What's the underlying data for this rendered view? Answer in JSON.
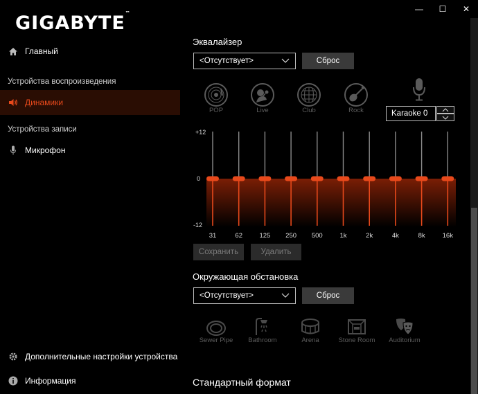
{
  "window": {
    "minimize": "—",
    "maximize": "☐",
    "close": "✕"
  },
  "brand": {
    "logo": "GIGABYTE",
    "tm": "™"
  },
  "sidebar": {
    "home": "Главный",
    "playback_section": "Устройства воспроизведения",
    "speakers": "Динамики",
    "recording_section": "Устройства записи",
    "microphone": "Микрофон",
    "advanced": "Дополнительные настройки устройства",
    "info": "Информация"
  },
  "equalizer": {
    "title": "Эквалайзер",
    "preset_value": "<Отсутствует>",
    "reset": "Сброс",
    "presets": [
      {
        "label": "POP"
      },
      {
        "label": "Live"
      },
      {
        "label": "Club"
      },
      {
        "label": "Rock"
      }
    ],
    "karaoke": "Karaoke 0",
    "scale": {
      "top": "+12",
      "mid": "0",
      "bottom": "-12"
    },
    "bands": [
      {
        "freq": "31",
        "gain": 0
      },
      {
        "freq": "62",
        "gain": 0
      },
      {
        "freq": "125",
        "gain": 0
      },
      {
        "freq": "250",
        "gain": 0
      },
      {
        "freq": "500",
        "gain": 0
      },
      {
        "freq": "1k",
        "gain": 0
      },
      {
        "freq": "2k",
        "gain": 0
      },
      {
        "freq": "4k",
        "gain": 0
      },
      {
        "freq": "8k",
        "gain": 0
      },
      {
        "freq": "16k",
        "gain": 0
      }
    ],
    "save": "Сохранить",
    "delete": "Удалить"
  },
  "environment": {
    "title": "Окружающая обстановка",
    "preset_value": "<Отсутствует>",
    "reset": "Сброс",
    "items": [
      {
        "label": "Sewer Pipe"
      },
      {
        "label": "Bathroom"
      },
      {
        "label": "Arena"
      },
      {
        "label": "Stone Room"
      },
      {
        "label": "Auditorium"
      }
    ]
  },
  "standard_format": {
    "title": "Стандартный формат"
  },
  "colors": {
    "accent": "#e8491b",
    "active_bg": "#2a0d03",
    "button": "#3a3a3a"
  }
}
